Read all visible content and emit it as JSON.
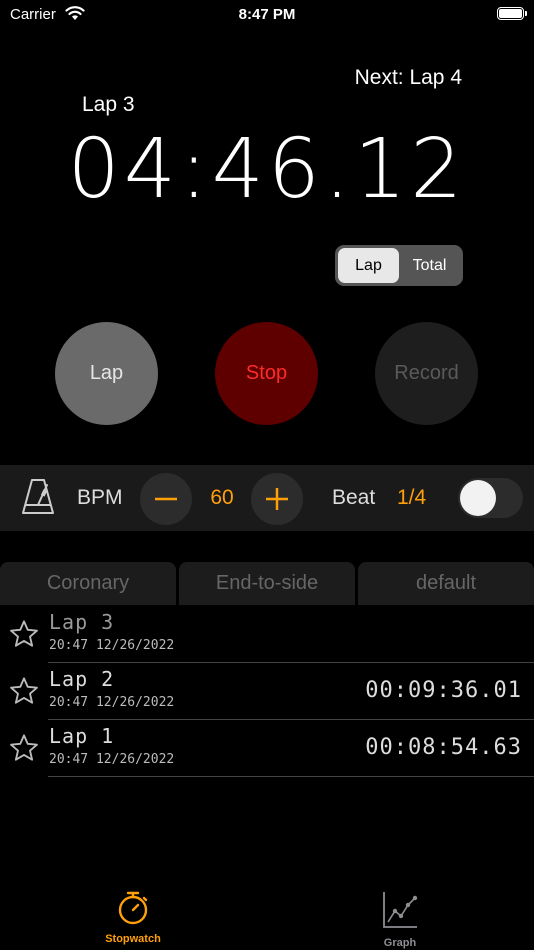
{
  "status_bar": {
    "carrier": "Carrier",
    "time": "8:47 PM"
  },
  "timer": {
    "next_lap": "Next: Lap 4",
    "current_lap": "Lap 3",
    "display": "04:46.12"
  },
  "mode_segment": {
    "options": [
      "Lap",
      "Total"
    ],
    "selected": "Lap"
  },
  "controls": {
    "lap": "Lap",
    "stop": "Stop",
    "record": "Record"
  },
  "metronome": {
    "bpm_label": "BPM",
    "bpm_value": "60",
    "beat_label": "Beat",
    "beat_value": "1/4",
    "enabled": false
  },
  "categories": [
    "Coronary",
    "End-to-side",
    "default"
  ],
  "laps": [
    {
      "name": "Lap 3",
      "date": "20:47 12/26/2022",
      "time": ""
    },
    {
      "name": "Lap 2",
      "date": "20:47 12/26/2022",
      "time": "00:09:36.01"
    },
    {
      "name": "Lap 1",
      "date": "20:47 12/26/2022",
      "time": "00:08:54.63"
    }
  ],
  "tab_bar": [
    {
      "label": "Stopwatch",
      "active": true
    },
    {
      "label": "Graph",
      "active": false
    }
  ],
  "colors": {
    "accent": "#ff9f0a",
    "stop_bg": "#5e0000",
    "stop_text": "#ff2a2a"
  }
}
